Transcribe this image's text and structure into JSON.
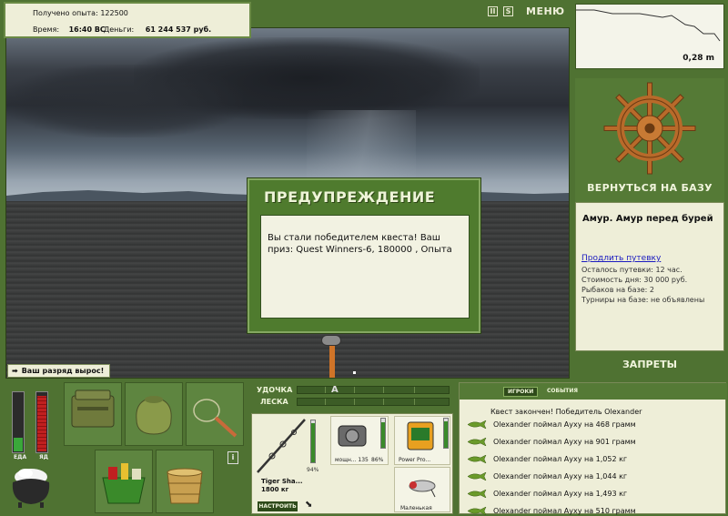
{
  "hud": {
    "experience_label": "Получено опыта:",
    "experience_value": "122500",
    "time_label": "Время:",
    "time_value": "16:40 ВС",
    "money_label": "Деньги:",
    "money_value": "61 244 537 руб."
  },
  "topbar": {
    "pause_icon_text": "II",
    "sound_icon_text": "S",
    "menu_label": "МЕНЮ"
  },
  "scene": {
    "rank_notice": "Ваш разряд вырос!"
  },
  "dialog": {
    "title": "ПРЕДУПРЕЖДЕНИЕ",
    "message": "Вы стали победителем квеста! Ваш приз: Quest Winners-6, 180000 , Опыта"
  },
  "minimap": {
    "distance": "0,28 m"
  },
  "base": {
    "return_label": "ВЕРНУТЬСЯ НА БАЗУ",
    "location": "Амур. Амур перед бурей",
    "extend_link": "Продлить путевку",
    "lines": [
      "Осталось путевки: 12 час.",
      "Стоимость дня: 30 000 руб.",
      "Рыбаков на базе: 2",
      "Турниры на базе: не объявлены"
    ],
    "bans_label": "ЗАПРЕТЫ"
  },
  "meters": {
    "food_label": "ЕДА",
    "poison_label": "ЯД",
    "food_level": 0.22,
    "poison_level": 0.92
  },
  "tackle": {
    "rod_label": "УДОЧКА",
    "line_label": "ЛЕСКА",
    "rod_name_1": "Tiger Sha...",
    "rod_name_2": "1800 кг",
    "rod_condition": "94%",
    "reel_name": "мощн... 135",
    "reel_condition": "86%",
    "line_name": "Power Pro...",
    "lure_name": "Маленькая",
    "setup_button": "НАСТРОИТЬ"
  },
  "chat": {
    "tab_players": "ИГРОКИ",
    "tab_events": "СОБЫТИЯ",
    "header": "Квест закончен! Победитель Olexander",
    "messages": [
      "Olexander поймал Ауху на 468 грамм",
      "Olexander поймал Ауху на 901 грамм",
      "Olexander поймал Ауху на 1,052 кг",
      "Olexander поймал Ауху на 1,044 кг",
      "Olexander поймал Ауху на 1,493 кг",
      "Olexander поймал Ауху на 510 грамм"
    ]
  }
}
